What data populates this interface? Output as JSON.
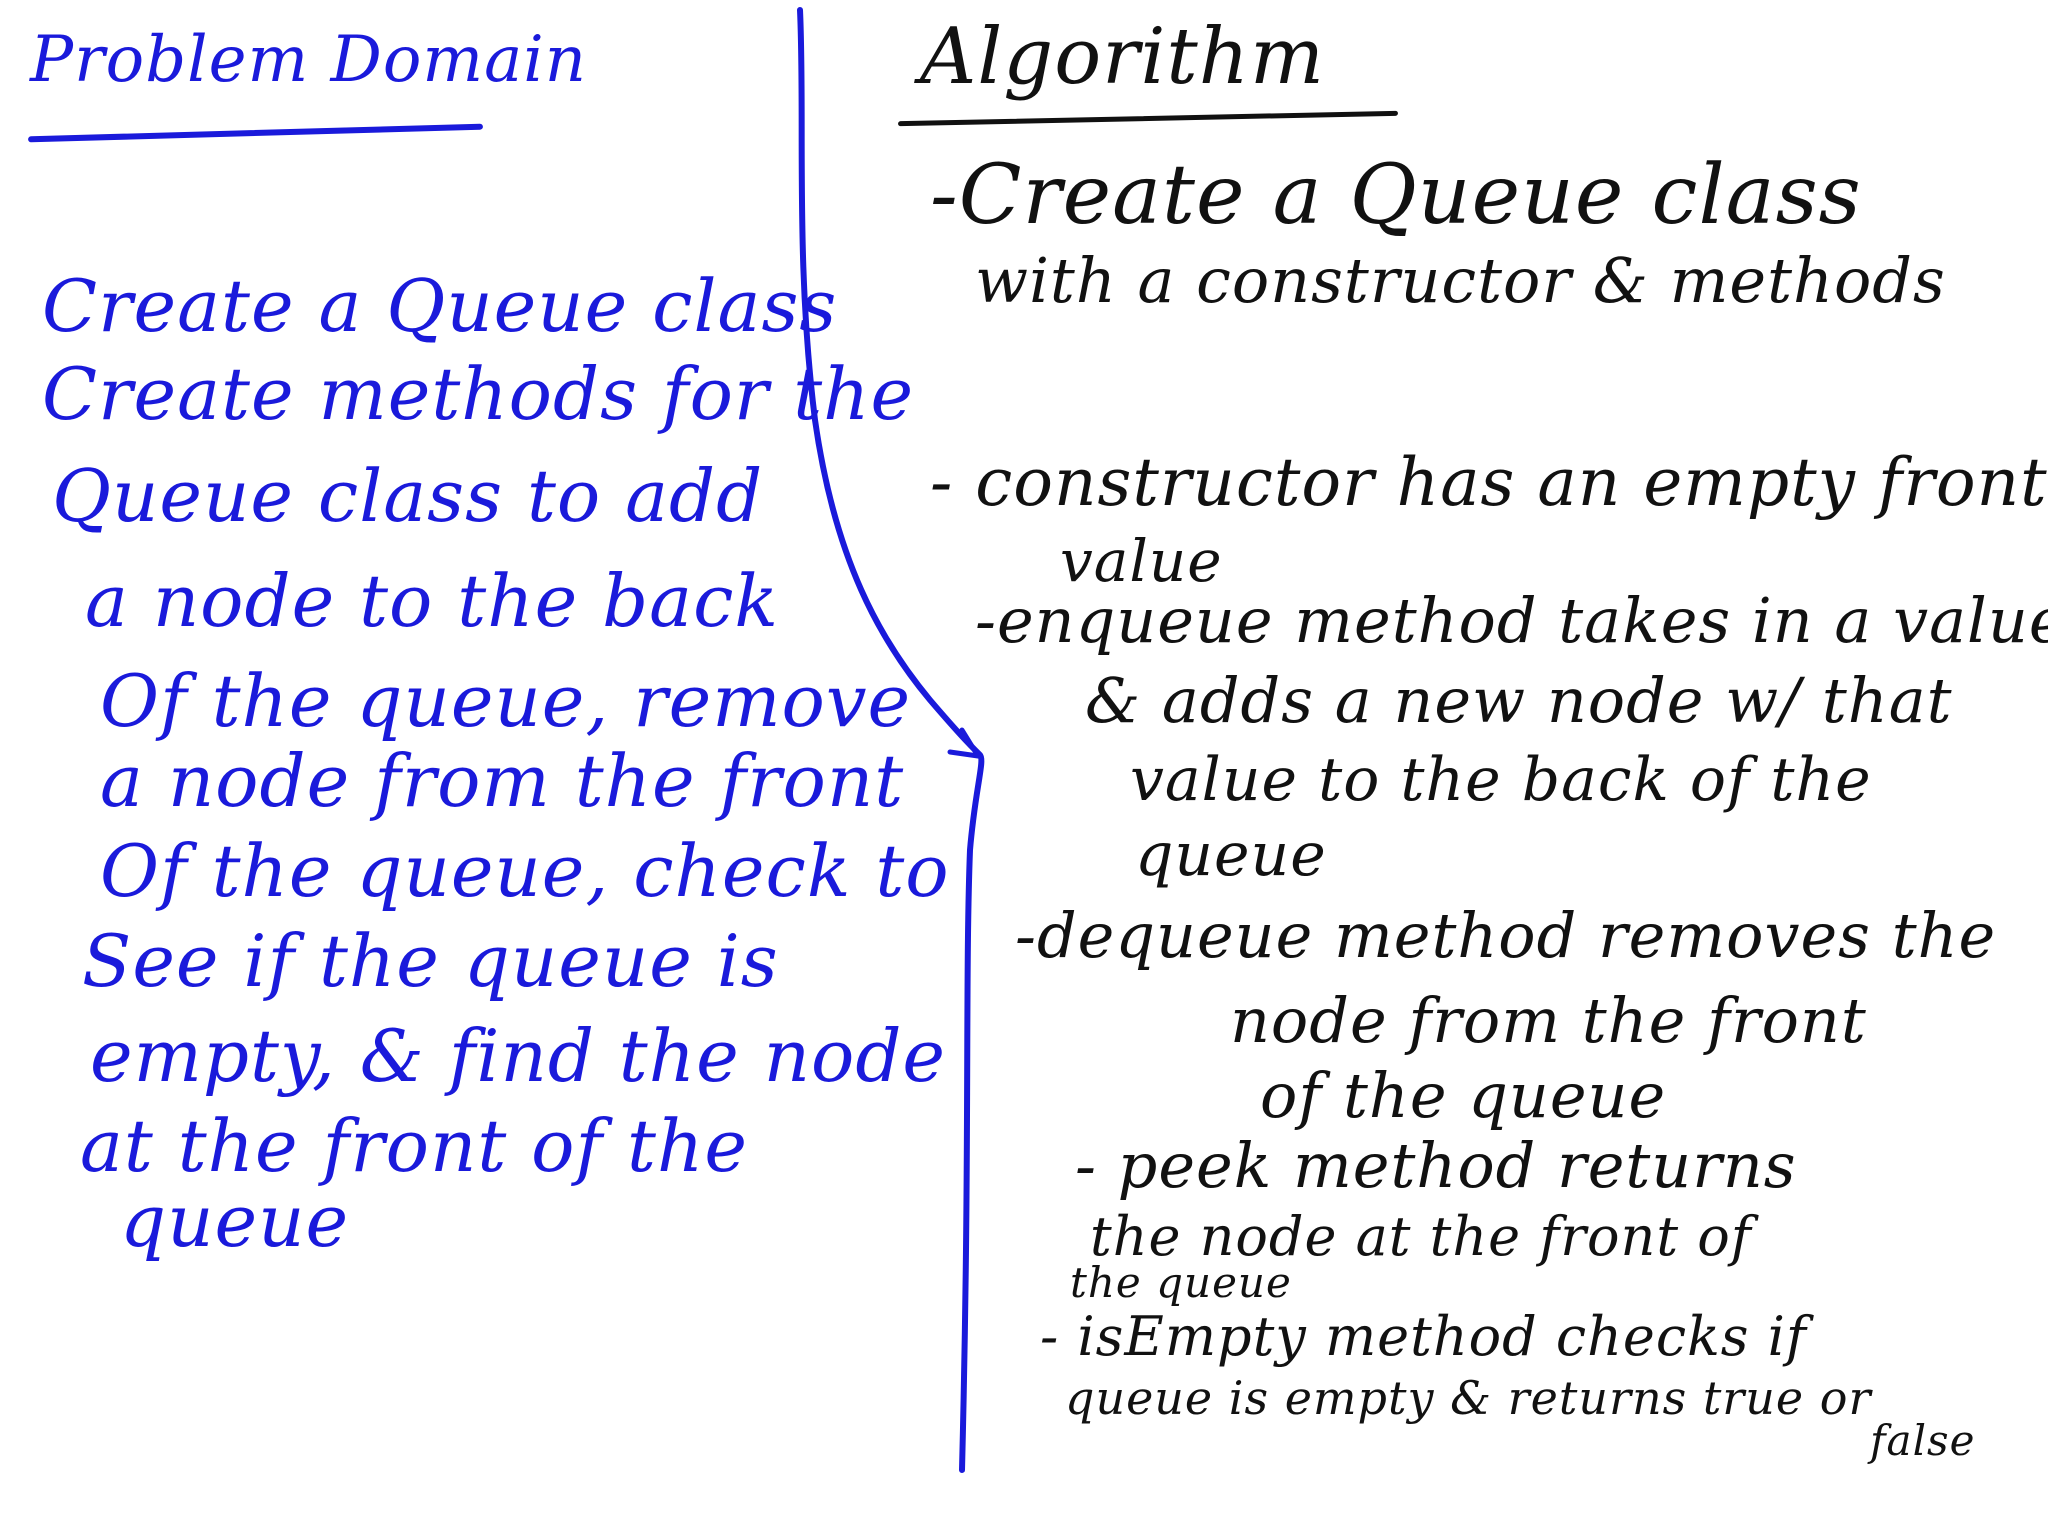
{
  "left": {
    "title": "Problem Domain",
    "lines": [
      "Create a Queue class",
      "Create methods for the",
      "Queue class to add",
      "a node to the back",
      "Of the queue, remove",
      "a node from the front",
      "Of the queue, check to",
      "See if the queue is",
      "empty, & find the node",
      "at the front of the",
      "queue"
    ]
  },
  "right": {
    "title": "Algorithm",
    "lines": [
      "-Create a Queue class",
      "with a constructor & methods",
      "- constructor has an empty front",
      "value",
      "-enqueue method takes in a value",
      "& adds a new node w/ that",
      "value to the back of the",
      "queue",
      "-dequeue method removes the",
      "node from the front",
      "of the queue",
      "- peek method returns",
      "the node at the front of",
      "the queue",
      "- isEmpty method checks if",
      "queue is empty & returns true or",
      "false"
    ]
  },
  "colors": {
    "left_ink": "#1a1adb",
    "right_ink": "#111111",
    "divider": "#1a1adb"
  }
}
